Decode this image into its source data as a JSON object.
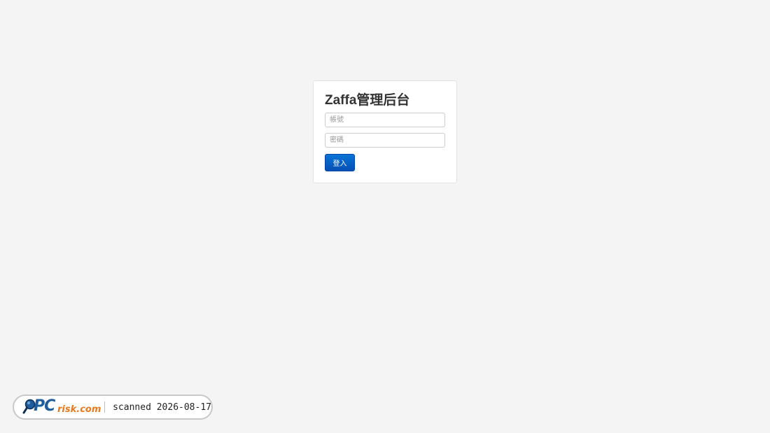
{
  "login": {
    "title": "Zaffa管理后台",
    "username_placeholder": "帳號",
    "password_placeholder": "密碼",
    "submit_label": "登入"
  },
  "watermark": {
    "brand_pc": "PC",
    "brand_risk": "risk.com",
    "scan_text": "scanned 2026-08-17"
  },
  "colors": {
    "background": "#f4f4f4",
    "button": "#0a74d6",
    "brand_blue": "#1f5c9c",
    "brand_orange": "#e8791e"
  }
}
